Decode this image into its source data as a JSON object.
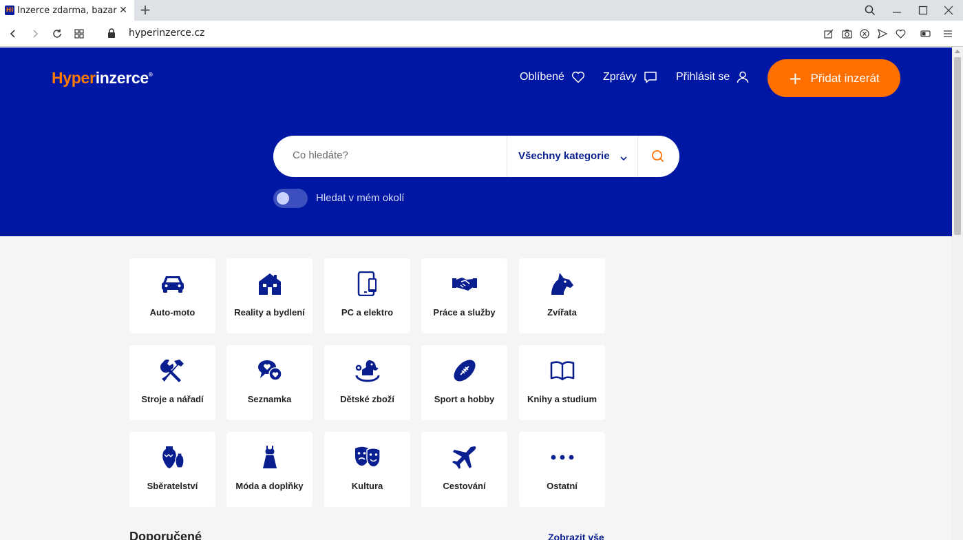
{
  "browser": {
    "tab_title": "Inzerce zdarma, bazar, inzeráty",
    "favicon_text": "Hi",
    "url": "hyperinzerce.cz"
  },
  "header": {
    "logo_part1": "Hyper",
    "logo_part2": "inzerce",
    "logo_reg": "®",
    "favorites_label": "Oblíbené",
    "messages_label": "Zprávy",
    "login_label": "Přihlásit se",
    "add_button_label": "Přidat inzerát"
  },
  "search": {
    "placeholder": "Co hledáte?",
    "category": "Všechny kategorie",
    "nearby_label": "Hledat v mém okolí",
    "nearby_enabled": false
  },
  "categories": [
    {
      "label": "Auto-moto",
      "icon": "car-icon"
    },
    {
      "label": "Reality a bydlení",
      "icon": "house-icon"
    },
    {
      "label": "PC a elektro",
      "icon": "tablet-icon"
    },
    {
      "label": "Práce a služby",
      "icon": "handshake-icon"
    },
    {
      "label": "Zvířata",
      "icon": "dog-icon"
    },
    {
      "label": "Stroje a nářadí",
      "icon": "tools-icon"
    },
    {
      "label": "Seznamka",
      "icon": "hearts-chat-icon"
    },
    {
      "label": "Dětské zboží",
      "icon": "rocking-horse-icon"
    },
    {
      "label": "Sport a hobby",
      "icon": "football-icon"
    },
    {
      "label": "Knihy a studium",
      "icon": "book-icon"
    },
    {
      "label": "Sběratelství",
      "icon": "vases-icon"
    },
    {
      "label": "Móda a doplňky",
      "icon": "dress-icon"
    },
    {
      "label": "Kultura",
      "icon": "theater-masks-icon"
    },
    {
      "label": "Cestování",
      "icon": "airplane-icon"
    },
    {
      "label": "Ostatní",
      "icon": "more-dots-icon"
    }
  ],
  "section": {
    "title": "Doporučené",
    "link": "Zobrazit vše"
  },
  "colors": {
    "brand_blue": "#0017a3",
    "brand_orange": "#ff7000",
    "icon_blue": "#0a1f8f"
  }
}
